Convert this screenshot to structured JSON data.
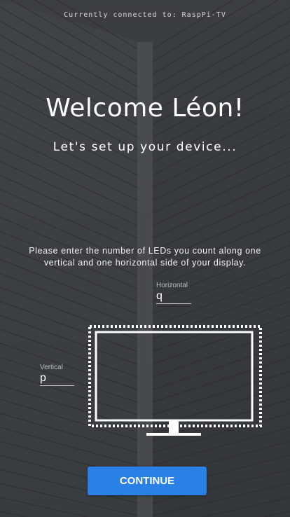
{
  "status": {
    "text": "Currently connected to: RaspPi-TV"
  },
  "header": {
    "welcome": "Welcome Léon!",
    "subtitle": "Let's set up  your device..."
  },
  "instruction": "Please enter the number of LEDs you count along one vertical and one horizontal side of your display.",
  "fields": {
    "horizontal": {
      "label": "Horizontal",
      "value": "q"
    },
    "vertical": {
      "label": "Vertical",
      "value": "p"
    }
  },
  "display_icon": "tv-monitor-icon",
  "continue_button": {
    "label": "CONTINUE",
    "color": "#2a80e6"
  },
  "colors": {
    "background": "#3a3d40",
    "accent": "#2a80e6"
  }
}
